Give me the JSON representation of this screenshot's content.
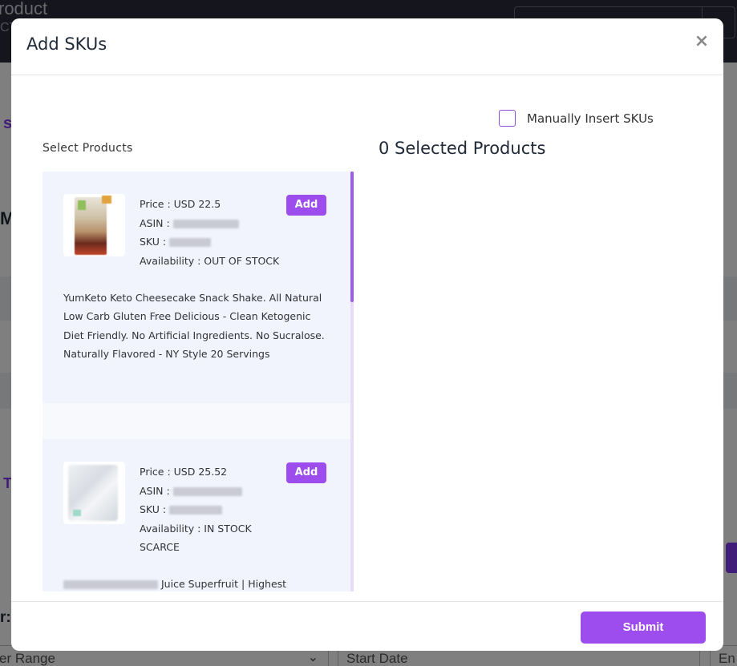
{
  "background": {
    "title": "roduct",
    "subtitle": "CT",
    "left_letters": [
      "s",
      "M",
      "T",
      "r:"
    ],
    "filter_range": "er Range",
    "start_date": "Start Date",
    "end_date": "En"
  },
  "modal": {
    "title": "Add SKUs",
    "close_symbol": "×",
    "manual_insert_label": "Manually Insert SKUs",
    "select_products_label": "Select Products",
    "selected_count_text": "0 Selected Products",
    "submit_label": "Submit"
  },
  "products": [
    {
      "price": "Price : USD 22.5",
      "asin_label": "ASIN :",
      "sku_label": "SKU :",
      "availability": "Availability : OUT OF STOCK",
      "availability_2": "",
      "add_label": "Add",
      "description": "YumKeto Keto Cheesecake Snack Shake. All Natural Low Carb Gluten Free Delicious - Clean Ketogenic Diet Friendly. No Artificial Ingredients. No Sucralose. Naturally Flavored - NY Style 20 Servings"
    },
    {
      "price": "Price : USD 25.52",
      "asin_label": "ASIN :",
      "sku_label": "SKU :",
      "availability": "Availability : IN STOCK",
      "availability_2": "SCARCE",
      "add_label": "Add",
      "description": "Juice Superfruit | Highest"
    }
  ],
  "colors": {
    "accent": "#9d4cee",
    "card_bg": "#f1f4fd",
    "scroll_thumb": "#9d5cf0"
  }
}
